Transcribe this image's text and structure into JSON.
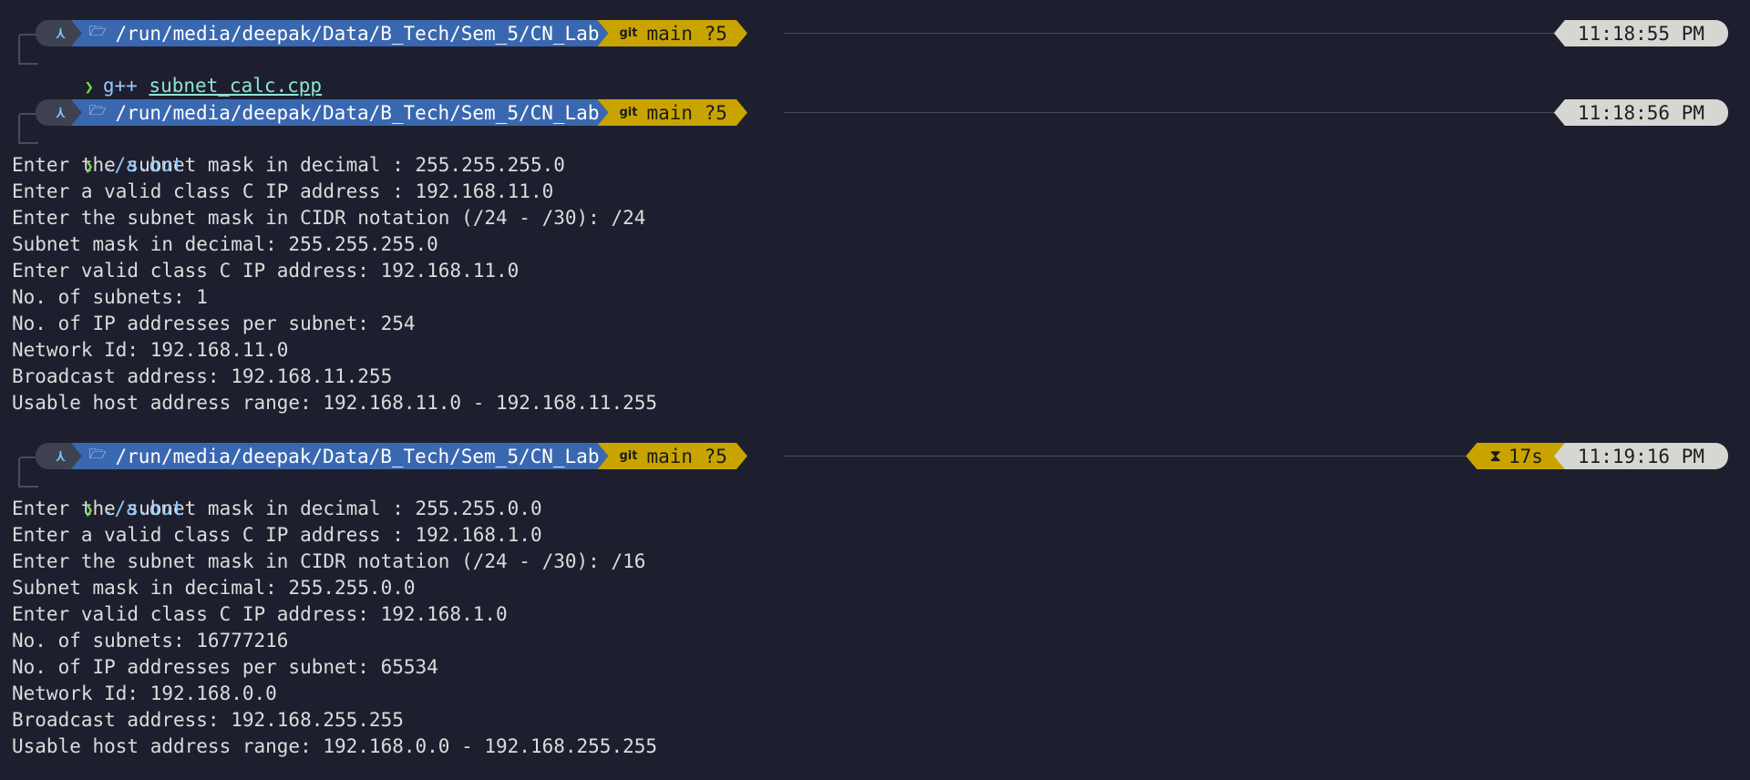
{
  "prompts": [
    {
      "os_icon": "arch-icon",
      "folder_icon": "folder-icon",
      "path": "/run/media/deepak/Data/B_Tech/Sem_5/CN_Lab",
      "git_icon": "git",
      "git_status": "main ?5",
      "duration": "",
      "time": "11:18:55 PM",
      "command": "g++",
      "argument": "subnet_calc.cpp",
      "output": []
    },
    {
      "os_icon": "arch-icon",
      "folder_icon": "folder-icon",
      "path": "/run/media/deepak/Data/B_Tech/Sem_5/CN_Lab",
      "git_icon": "git",
      "git_status": "main ?5",
      "duration": "",
      "time": "11:18:56 PM",
      "command": "./a.out",
      "argument": "",
      "output": [
        "Enter the subnet mask in decimal : 255.255.255.0",
        "Enter a valid class C IP address : 192.168.11.0",
        "Enter the subnet mask in CIDR notation (/24 - /30): /24",
        "Subnet mask in decimal: 255.255.255.0",
        "Enter valid class C IP address: 192.168.11.0",
        "No. of subnets: 1",
        "No. of IP addresses per subnet: 254",
        "Network Id: 192.168.11.0",
        "Broadcast address: 192.168.11.255",
        "Usable host address range: 192.168.11.0 - 192.168.11.255"
      ]
    },
    {
      "os_icon": "arch-icon",
      "folder_icon": "folder-icon",
      "path": "/run/media/deepak/Data/B_Tech/Sem_5/CN_Lab",
      "git_icon": "git",
      "git_status": "main ?5",
      "duration": "17s",
      "time": "11:19:16 PM",
      "command": "./a.out",
      "argument": "",
      "output": [
        "Enter the subnet mask in decimal : 255.255.0.0",
        "Enter a valid class C IP address : 192.168.1.0",
        "Enter the subnet mask in CIDR notation (/24 - /30): /16",
        "Subnet mask in decimal: 255.255.0.0",
        "Enter valid class C IP address: 192.168.1.0",
        "No. of subnets: 16777216",
        "No. of IP addresses per subnet: 65534",
        "Network Id: 192.168.0.0",
        "Broadcast address: 192.168.255.255",
        "Usable host address range: 192.168.0.0 - 192.168.255.255"
      ]
    }
  ],
  "colors": {
    "background": "#1e1f2e",
    "os_segment": "#3e4250",
    "path_segment": "#3a68b0",
    "git_segment": "#c9a400",
    "time_segment": "#d6d6d2",
    "prompt_chevron": "#7adf3b",
    "command": "#8ec9ff"
  }
}
